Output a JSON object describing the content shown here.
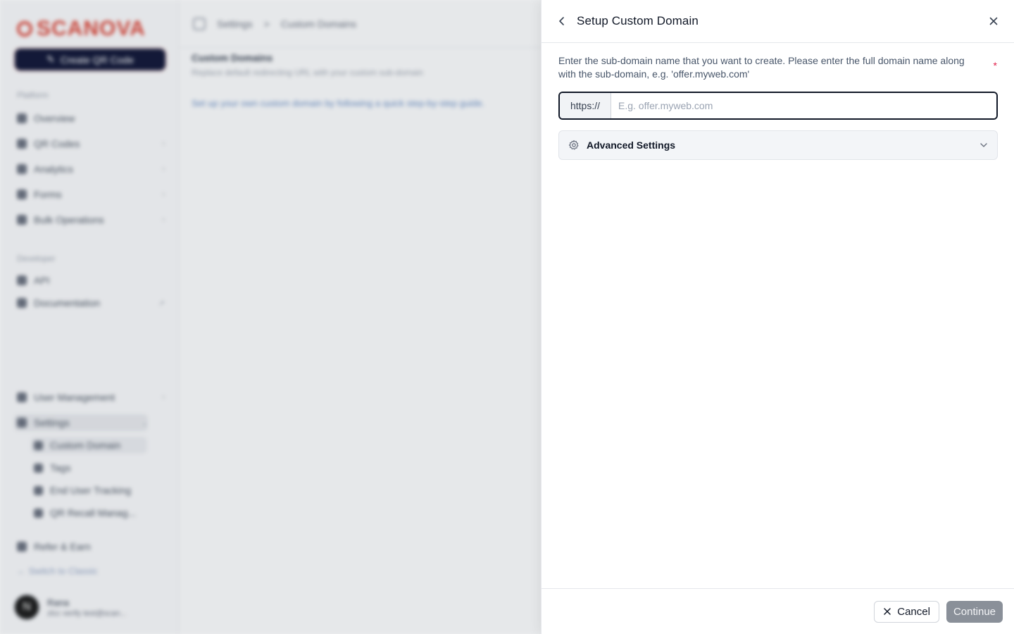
{
  "background": {
    "logo": "SCANOVA",
    "create_button": "Create QR Code",
    "sections": {
      "platform": "Platform",
      "developer": "Developer"
    },
    "nav": [
      "Overview",
      "QR Codes",
      "Analytics",
      "Forms",
      "Bulk Operations"
    ],
    "developer_nav": [
      "API",
      "Documentation"
    ],
    "bottom_nav": [
      "User Management",
      "Settings"
    ],
    "settings_sub": [
      "Custom Domain",
      "Tags",
      "End User Tracking",
      "QR Recall Manag..."
    ],
    "refer": "Refer & Earn",
    "switch_link": "Switch to Classic",
    "profile": {
      "initial": "N",
      "name": "Rana",
      "email": "zlcc verify test@scan..."
    },
    "breadcrumb": {
      "first": "Settings",
      "sep": ">",
      "second": "Custom Domains"
    },
    "page_title": "Custom Domains",
    "page_subtitle": "Replace default redirecting URL with your custom sub-domain",
    "page_description": "Set up your own custom domain by following a quick step-by-step guide."
  },
  "drawer": {
    "title": "Setup Custom Domain",
    "field_label": "Enter the sub-domain name that you want to create. Please enter the full domain name along with the sub-domain, e.g. 'offer.myweb.com'",
    "required_marker": "*",
    "input_prefix": "https://",
    "input_value": "",
    "input_placeholder": "E.g. offer.myweb.com",
    "advanced_settings_label": "Advanced Settings",
    "cancel_label": "Cancel",
    "continue_label": "Continue"
  }
}
